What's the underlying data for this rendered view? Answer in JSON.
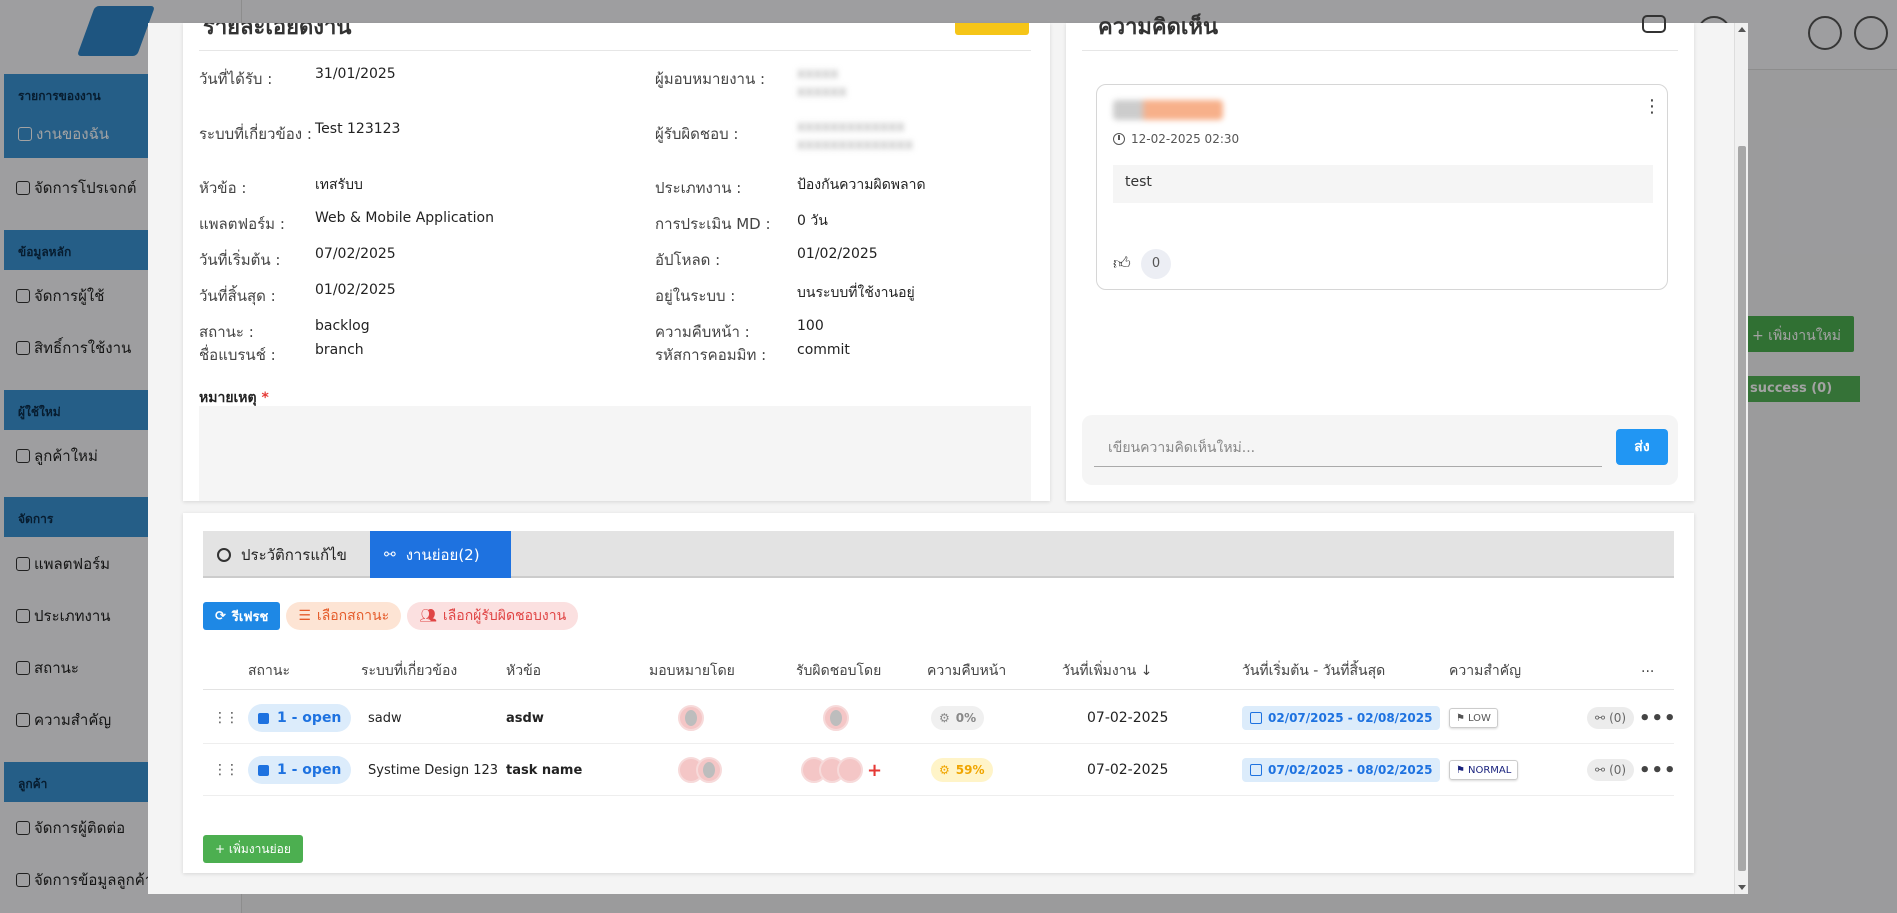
{
  "background": {
    "sections": [
      "รายการของงาน",
      "ข้อมูลหลัก",
      "ผู้ใช้ใหม่",
      "จัดการ",
      "ลูกค้า"
    ],
    "items": {
      "my_tasks": "งานของฉัน",
      "projects": "จัดการโปรเจกต์",
      "users": "จัดการผู้ใช้",
      "permissions": "สิทธิ์การใช้งาน",
      "new_customer": "ลูกค้าใหม่",
      "platform": "แพลตฟอร์ม",
      "task_type": "ประเภทงาน",
      "status": "สถานะ",
      "priority": "ความสำคัญ",
      "contacts": "จัดการผู้ติดต่อ",
      "customer_data": "จัดการข้อมูลลูกค้า"
    },
    "add_task_button": "+ เพิ่มงานใหม่",
    "success_label": "success  (0)"
  },
  "detail": {
    "title": "รายละเอียดงาน",
    "fields": {
      "received_date": {
        "label": "วันที่ได้รับ :",
        "value": "31/01/2025"
      },
      "assigner": {
        "label": "ผู้มอบหมายงาน :",
        "value": "xxxxx xxxxxx"
      },
      "related_system": {
        "label": "ระบบที่เกี่ยวข้อง :",
        "value": "Test 123123"
      },
      "responsible": {
        "label": "ผู้รับผิดชอบ :",
        "value": "xxxxxxxxxxxxx xxxxxxxxxxxxxx"
      },
      "topic": {
        "label": "หัวข้อ :",
        "value": "เทสรับบ"
      },
      "task_type": {
        "label": "ประเภทงาน :",
        "value": "ป้องกันความผิดพลาด"
      },
      "platform": {
        "label": "แพลตฟอร์ม :",
        "value": "Web & Mobile Application"
      },
      "md_estimate": {
        "label": "การประเมิน MD :",
        "value": "0 วัน"
      },
      "start_date": {
        "label": "วันที่เริ่มต้น :",
        "value": "07/02/2025"
      },
      "upload": {
        "label": "อัปโหลด :",
        "value": "01/02/2025"
      },
      "end_date": {
        "label": "วันที่สิ้นสุด :",
        "value": "01/02/2025"
      },
      "in_system": {
        "label": "อยู่ในระบบ :",
        "value": "บนระบบที่ใช้งานอยู่"
      },
      "status": {
        "label": "สถานะ :",
        "value": "backlog"
      },
      "progress": {
        "label": "ความคืบหน้า :",
        "value": "100"
      },
      "branch": {
        "label": "ชื่อแบรนช์ :",
        "value": "branch"
      },
      "commit": {
        "label": "รหัสการคอมมิท :",
        "value": "commit"
      }
    },
    "note_label": "หมายเหตุ",
    "note_required": "*"
  },
  "comments": {
    "title": "ความคิดเห็น",
    "items": [
      {
        "timestamp": "12-02-2025 02:30",
        "body": "test",
        "likes": "0"
      }
    ],
    "input_placeholder": "เขียนความคิดเห็นใหม่...",
    "send_label": "ส่ง"
  },
  "subtasks": {
    "tabs": {
      "history": "ประวัติการแก้ไข",
      "subtasks": "งานย่อย(2)"
    },
    "filters": {
      "refresh": "รีเฟรช",
      "status": "เลือกสถานะ",
      "assignee": "เลือกผู้รับผิดชอบงาน"
    },
    "headers": [
      "สถานะ",
      "ระบบที่เกี่ยวข้อง",
      "หัวข้อ",
      "มอบหมายโดย",
      "รับผิดชอบโดย",
      "ความคืบหน้า",
      "วันที่เพิ่มงาน",
      "วันที่เริ่มต้น - วันที่สิ้นสุด",
      "ความสำคัญ",
      "..."
    ],
    "rows": [
      {
        "status": "1 - open",
        "system": "sadw",
        "topic": "asdw",
        "progress": "0%",
        "added": "07-02-2025",
        "range": "02/07/2025 - 02/08/2025",
        "priority": "LOW",
        "subcount": "(0)"
      },
      {
        "status": "1 - open",
        "system": "Systime Design 123",
        "topic": "task name",
        "progress": "59%",
        "added": "07-02-2025",
        "range": "07/02/2025 - 08/02/2025",
        "priority": "NORMAL",
        "subcount": "(0)"
      }
    ],
    "add_button": "+ เพิ่มงานย่อย"
  },
  "colors": {
    "primary": "#1e72e0",
    "success": "#4caf50",
    "accent_orange": "#e55c2b",
    "danger": "#e53935"
  }
}
